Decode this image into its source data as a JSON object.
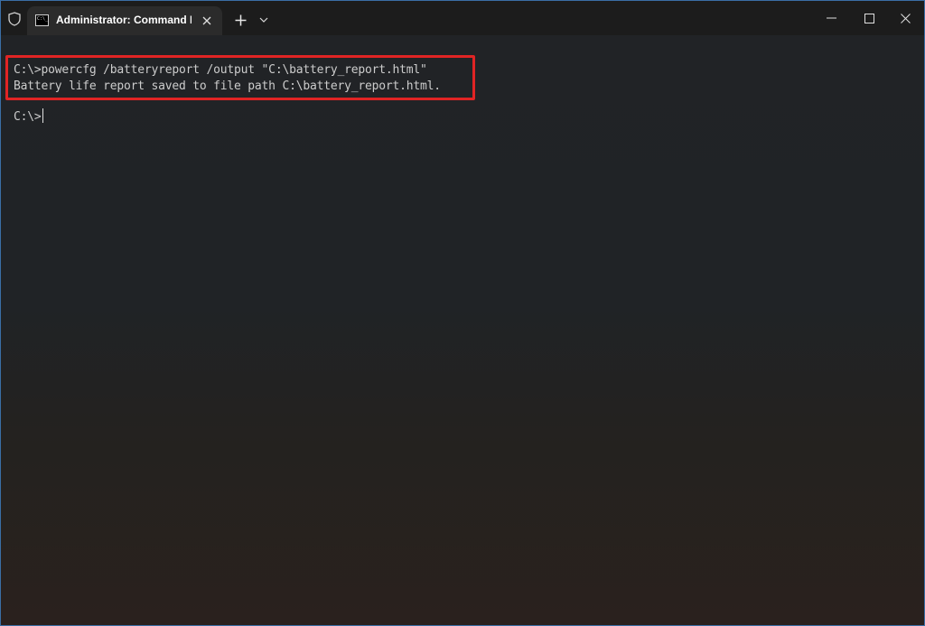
{
  "titlebar": {
    "tab_title": "Administrator: Command Prompt",
    "icons": {
      "shield": "shield-icon",
      "tab": "command-prompt-icon",
      "close_tab": "close-icon",
      "new_tab": "plus-icon",
      "dropdown": "chevron-down-icon",
      "minimize": "minimize-icon",
      "maximize": "maximize-icon",
      "close_window": "close-icon"
    }
  },
  "terminal": {
    "lines": [
      "C:\\>powercfg /batteryreport /output \"C:\\battery_report.html\"",
      "Battery life report saved to file path C:\\battery_report.html.",
      "C:\\>"
    ]
  },
  "colors": {
    "highlight_border": "#e02424",
    "text": "#cccccc",
    "titlebar": "#1c1c1c",
    "active_tab": "#2b2b2b"
  }
}
